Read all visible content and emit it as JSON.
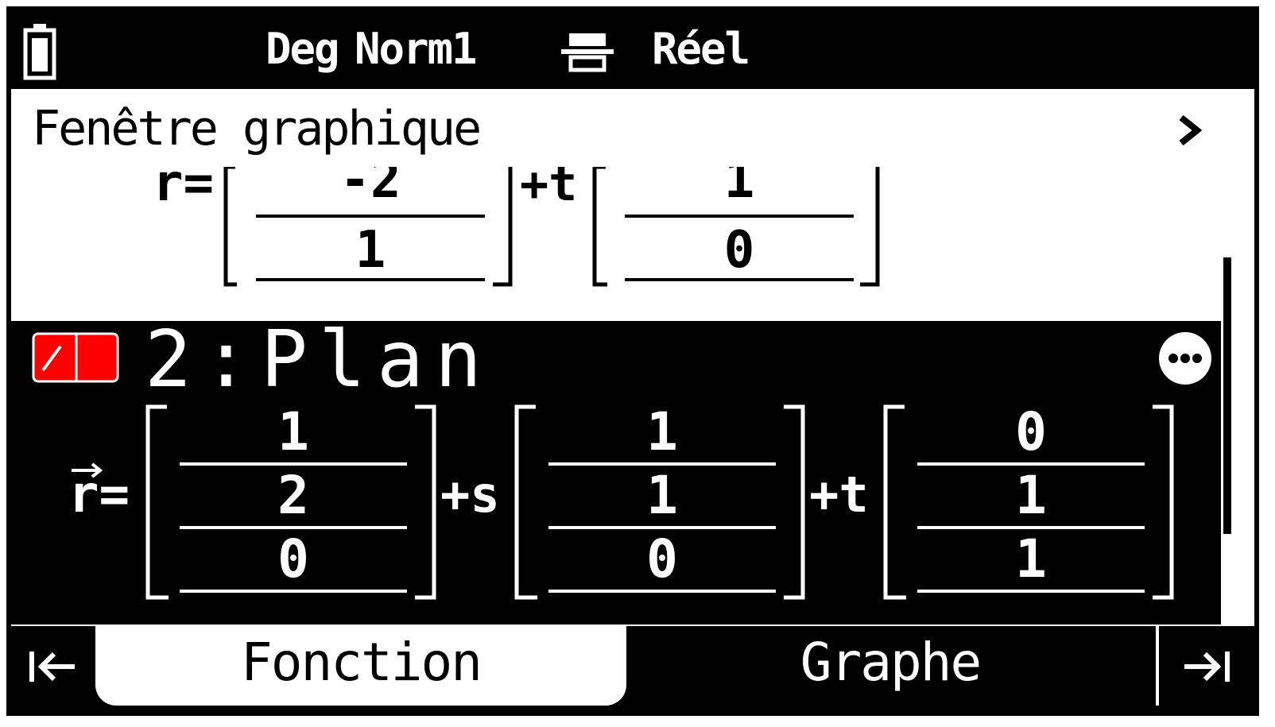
{
  "status": {
    "angle": "Deg",
    "display": "Norm1",
    "complex": "Réel",
    "battery_icon": "battery-icon",
    "input_icon": "math-input-icon"
  },
  "window": {
    "title": "Fenêtre graphique",
    "chevron_icon": "chevron-right-icon"
  },
  "prev_equation": {
    "lhs": "r=",
    "vec1": [
      "-2",
      "1"
    ],
    "op1": "+t",
    "vec2": [
      "1",
      "0"
    ]
  },
  "selected_equation": {
    "title": "2:Plan",
    "toggle_color": "#ff0000",
    "lhs": "r=",
    "point": [
      "1",
      "2",
      "0"
    ],
    "op1": "+s",
    "dir1": [
      "1",
      "1",
      "0"
    ],
    "op2": "+t",
    "dir2": [
      "0",
      "1",
      "1"
    ],
    "more_icon": "more-options-icon"
  },
  "tabs": {
    "prev_icon": "tab-prev-icon",
    "fonction": "Fonction",
    "graphe": "Graphe",
    "next_icon": "tab-next-icon",
    "active": "Fonction"
  }
}
